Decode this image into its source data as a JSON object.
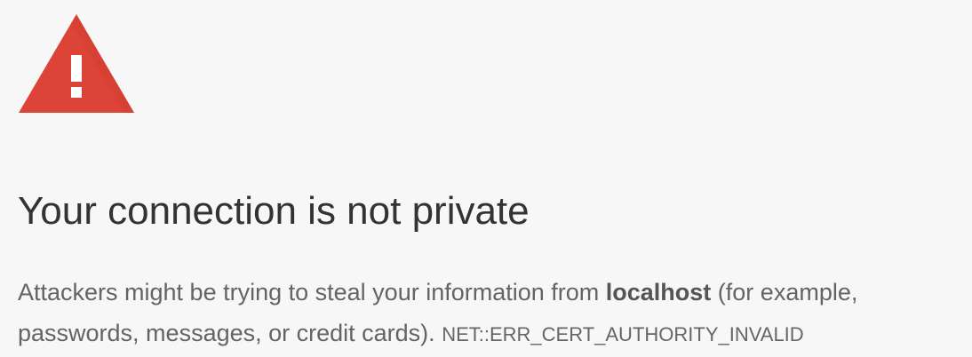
{
  "icon": {
    "name": "warning-triangle-icon",
    "color": "#db4437",
    "mark_color": "#ffffff"
  },
  "heading": "Your connection is not private",
  "explanation": {
    "prefix": "Attackers might be trying to steal your information from ",
    "host": "localhost",
    "suffix": " (for example, passwords, messages, or credit cards).",
    "error_code": "NET::ERR_CERT_AUTHORITY_INVALID"
  }
}
